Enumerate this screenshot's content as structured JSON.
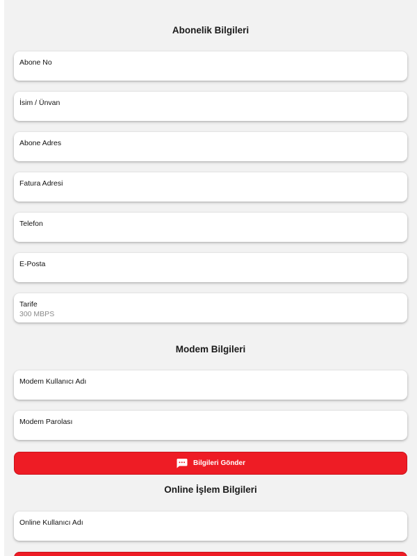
{
  "subscription": {
    "title": "Abonelik Bilgileri",
    "fields": [
      {
        "label": "Abone No",
        "value": ""
      },
      {
        "label": "İsim / Ünvan",
        "value": ""
      },
      {
        "label": "Abone Adres",
        "value": ""
      },
      {
        "label": "Fatura Adresi",
        "value": ""
      },
      {
        "label": "Telefon",
        "value": ""
      },
      {
        "label": "E-Posta",
        "value": ""
      },
      {
        "label": "Tarife",
        "value": "300 MBPS"
      }
    ]
  },
  "modem": {
    "title": "Modem Bilgileri",
    "fields": [
      {
        "label": "Modem Kullanıcı Adı",
        "value": ""
      },
      {
        "label": "Modem Parolası",
        "value": ""
      }
    ],
    "submit_label": "Bilgileri Gönder",
    "submit_icon": "chat-icon",
    "submit_color": "#ee1c25"
  },
  "online": {
    "title": "Online İşlem Bilgileri",
    "fields": [
      {
        "label": "Online Kullanıcı Adı",
        "value": ""
      }
    ]
  },
  "colors": {
    "background": "#f2f2f2",
    "accent": "#ee1c25"
  }
}
